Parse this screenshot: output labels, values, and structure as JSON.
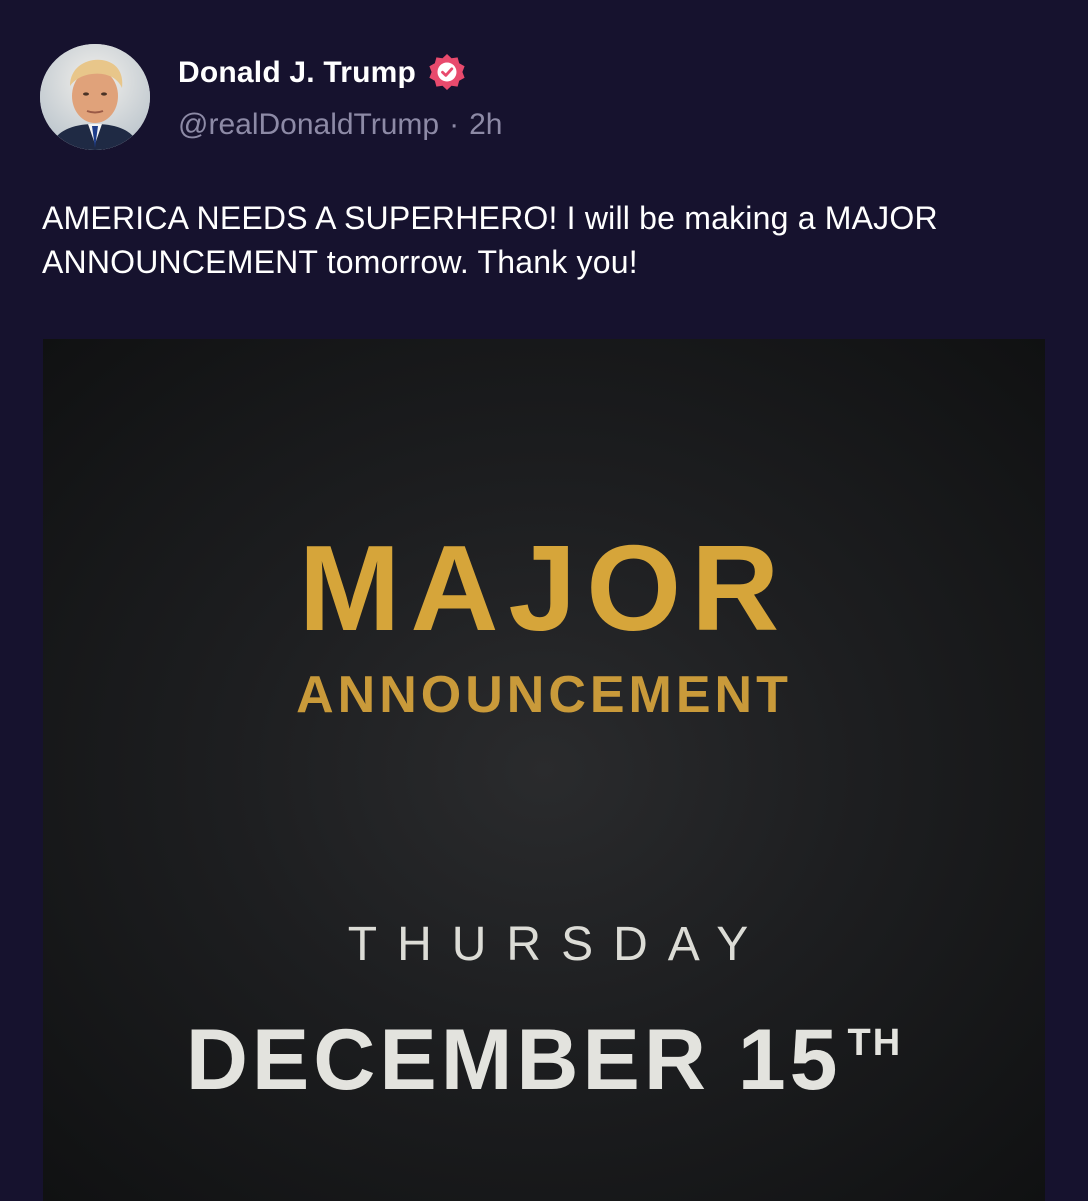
{
  "author": {
    "name": "Donald J. Trump",
    "handle": "@realDonaldTrump",
    "separator": "·",
    "timestamp": "2h",
    "verified_icon": "verified-badge-icon",
    "badge_color": "#e84a6d"
  },
  "post": {
    "text": "AMERICA NEEDS A SUPERHERO! I will be making a MAJOR ANNOUNCEMENT tomorrow. Thank you!"
  },
  "media": {
    "line1": "MAJOR",
    "line2": "ANNOUNCEMENT",
    "line3": "THURSDAY",
    "line4_main": "DECEMBER 15",
    "line4_suffix": "TH",
    "gold_color": "#d6a53a"
  },
  "colors": {
    "background": "#16122e",
    "meta_text": "#8d8aa6"
  }
}
